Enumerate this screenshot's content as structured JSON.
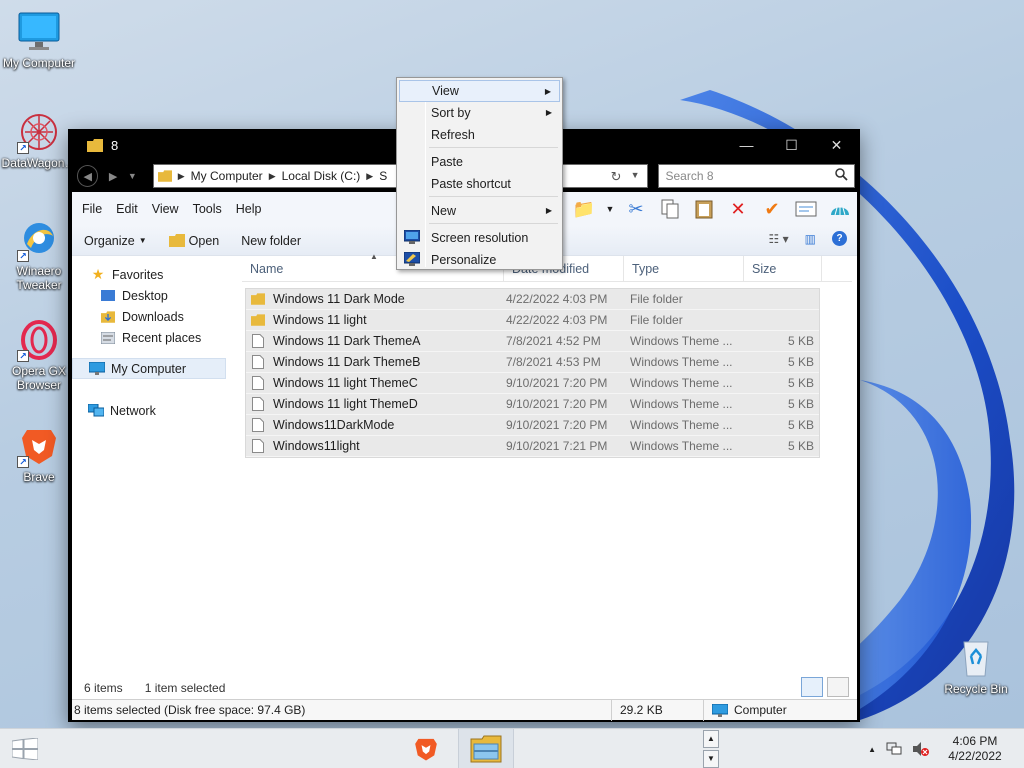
{
  "desktop": {
    "icons": [
      {
        "label": "My Computer"
      },
      {
        "label": "DataWagon…"
      },
      {
        "label": "Winaero Tweaker"
      },
      {
        "label": "Opera GX Browser"
      },
      {
        "label": "Brave"
      },
      {
        "label": "Recycle Bin"
      }
    ]
  },
  "window": {
    "title": "8",
    "breadcrumbs": [
      "My Computer",
      "Local Disk (C:)",
      "S"
    ],
    "search_placeholder": "Search 8",
    "menu": [
      "File",
      "Edit",
      "View",
      "Tools",
      "Help"
    ],
    "commands": {
      "organize": "Organize",
      "open": "Open",
      "new_folder": "New folder"
    },
    "nav": {
      "favorites": "Favorites",
      "desktop": "Desktop",
      "downloads": "Downloads",
      "recent": "Recent places",
      "computer": "My Computer",
      "network": "Network"
    },
    "columns": {
      "name": "Name",
      "date": "Date modified",
      "type": "Type",
      "size": "Size"
    },
    "files": [
      {
        "name": "Windows 11 Dark Mode",
        "date": "4/22/2022 4:03 PM",
        "type": "File folder",
        "size": "",
        "kind": "folder"
      },
      {
        "name": "Windows 11 light",
        "date": "4/22/2022 4:03 PM",
        "type": "File folder",
        "size": "",
        "kind": "folder"
      },
      {
        "name": "Windows 11 Dark  ThemeA",
        "date": "7/8/2021 4:52 PM",
        "type": "Windows Theme ...",
        "size": "5 KB",
        "kind": "file"
      },
      {
        "name": "Windows 11 Dark  ThemeB",
        "date": "7/8/2021 4:53 PM",
        "type": "Windows Theme ...",
        "size": "5 KB",
        "kind": "file"
      },
      {
        "name": "Windows 11 light ThemeC",
        "date": "9/10/2021 7:20 PM",
        "type": "Windows Theme ...",
        "size": "5 KB",
        "kind": "file"
      },
      {
        "name": "Windows 11 light ThemeD",
        "date": "9/10/2021 7:20 PM",
        "type": "Windows Theme ...",
        "size": "5 KB",
        "kind": "file"
      },
      {
        "name": "Windows11DarkMode",
        "date": "9/10/2021 7:20 PM",
        "type": "Windows Theme ...",
        "size": "5 KB",
        "kind": "file"
      },
      {
        "name": "Windows11light",
        "date": "9/10/2021 7:21 PM",
        "type": "Windows Theme ...",
        "size": "5 KB",
        "kind": "file"
      }
    ],
    "status": {
      "items": "6 items",
      "selected": "1 item selected",
      "detail": "8 items selected (Disk free space: 97.4 GB)",
      "size": "29.2 KB",
      "location": "Computer"
    }
  },
  "context_menu": {
    "view": "View",
    "sort_by": "Sort by",
    "refresh": "Refresh",
    "paste": "Paste",
    "paste_shortcut": "Paste shortcut",
    "new": "New",
    "screen_resolution": "Screen resolution",
    "personalize": "Personalize"
  },
  "taskbar": {
    "time": "4:06 PM",
    "date": "4/22/2022"
  },
  "colors": {
    "accent_blue": "#0a55d8",
    "selection_gray": "#e9e9e9",
    "menu_highlight": "#e8f0fb"
  }
}
